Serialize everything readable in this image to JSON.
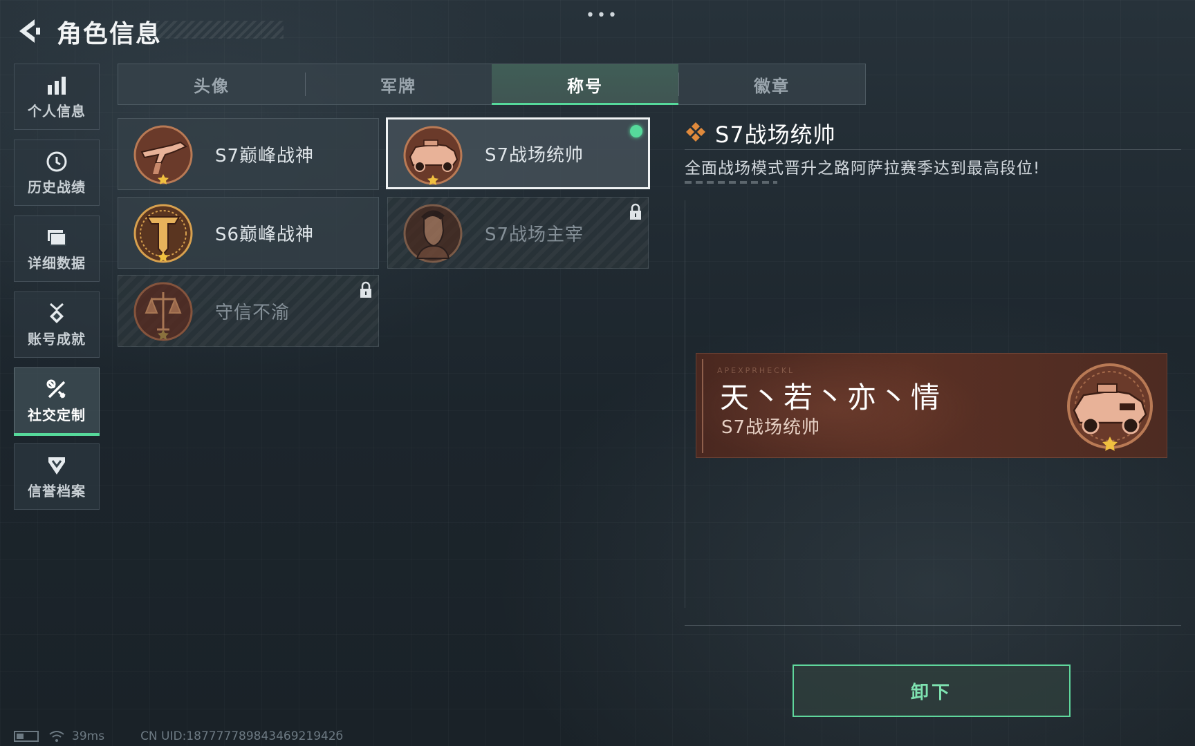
{
  "header": {
    "title": "角色信息"
  },
  "top_dots": "•••",
  "sidebar": {
    "items": [
      {
        "label": "个人信息",
        "icon": "bar-chart-icon",
        "active": false
      },
      {
        "label": "历史战绩",
        "icon": "clock-icon",
        "active": false
      },
      {
        "label": "详细数据",
        "icon": "folder-icon",
        "active": false
      },
      {
        "label": "账号成就",
        "icon": "medal-icon",
        "active": false
      },
      {
        "label": "社交定制",
        "icon": "tools-icon",
        "active": true
      },
      {
        "label": "信誉档案",
        "icon": "shield-chevron-icon",
        "active": false
      }
    ]
  },
  "tabs": [
    {
      "label": "头像",
      "active": false
    },
    {
      "label": "军牌",
      "active": false
    },
    {
      "label": "称号",
      "active": true
    },
    {
      "label": "徽章",
      "active": false
    }
  ],
  "titles": [
    {
      "name": "S7巅峰战神",
      "locked": false,
      "selected": false,
      "equipped": false,
      "badge": "gun-badge-icon"
    },
    {
      "name": "S7战场统帅",
      "locked": false,
      "selected": true,
      "equipped": true,
      "badge": "armored-vehicle-badge-icon"
    },
    {
      "name": "S6巅峰战神",
      "locked": false,
      "selected": false,
      "equipped": false,
      "badge": "t-emblem-badge-icon"
    },
    {
      "name": "S7战场主宰",
      "locked": true,
      "selected": false,
      "equipped": false,
      "badge": "soldier-portrait-badge-icon"
    },
    {
      "name": "守信不渝",
      "locked": true,
      "selected": false,
      "equipped": false,
      "badge": "scales-badge-icon"
    }
  ],
  "detail": {
    "name": "S7战场统帅",
    "description": "全面战场模式晋升之路阿萨拉赛季达到最高段位!"
  },
  "nameplate": {
    "player_name": "天丶若丶亦丶情",
    "title": "S7战场统帅",
    "faint_text": "APEXPRHECKL"
  },
  "unequip_button": {
    "label": "卸下"
  },
  "status_bar": {
    "ping": "39ms",
    "uid": "CN UID:18777778984346921942б"
  },
  "colors": {
    "accent_green": "#56d99b",
    "badge_bronze": "#b97a55",
    "nameplate_bg": "#5a3024"
  }
}
